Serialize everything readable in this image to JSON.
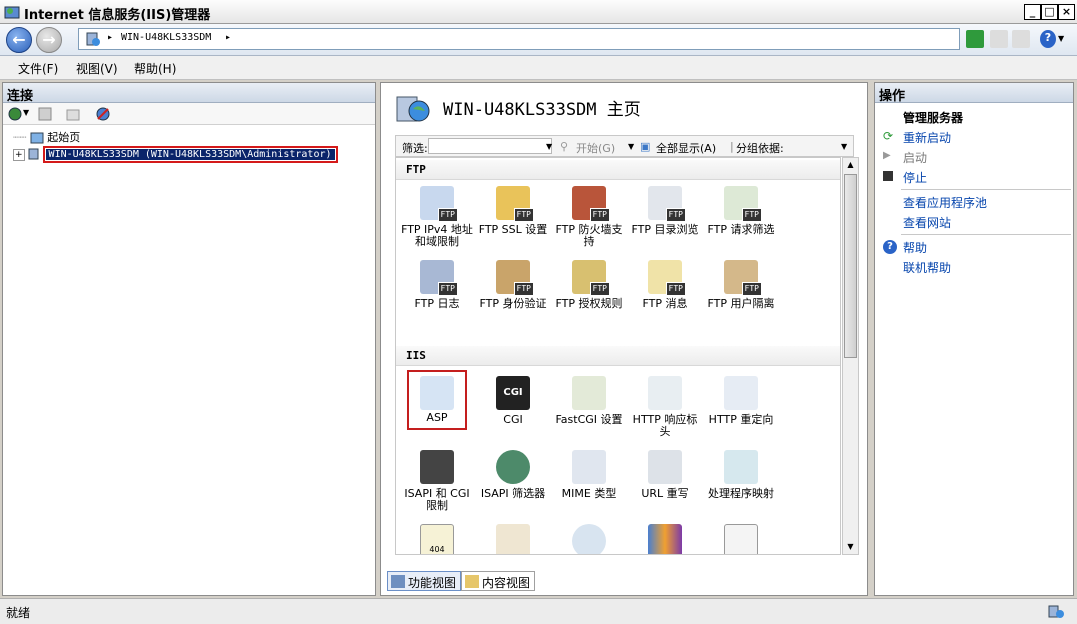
{
  "window": {
    "title": "Internet 信息服务(IIS)管理器"
  },
  "address": {
    "crumbs": [
      "WIN-U48KLS33SDM"
    ]
  },
  "menu": [
    "文件(F)",
    "视图(V)",
    "帮助(H)"
  ],
  "connections": {
    "title": "连接",
    "tree": [
      {
        "label": "起始页"
      },
      {
        "label": "WIN-U48KLS33SDM (WIN-U48KLS33SDM\\Administrator)",
        "selected": true
      }
    ]
  },
  "center": {
    "title": "WIN-U48KLS33SDM 主页",
    "filter": {
      "label": "筛选:",
      "start": "开始(G)",
      "show_all": "全部显示(A)",
      "group_by": "分组依据:"
    },
    "sections": [
      {
        "name": "FTP",
        "items": [
          {
            "label": "FTP IPv4 地址和域限制",
            "icon": "ftp-ip-restrict-icon"
          },
          {
            "label": "FTP SSL 设置",
            "icon": "ftp-ssl-icon"
          },
          {
            "label": "FTP 防火墙支持",
            "icon": "ftp-firewall-icon"
          },
          {
            "label": "FTP 目录浏览",
            "icon": "ftp-directory-icon"
          },
          {
            "label": "FTP 请求筛选",
            "icon": "ftp-request-filter-icon"
          },
          {
            "label": "FTP 日志",
            "icon": "ftp-log-icon"
          },
          {
            "label": "FTP 身份验证",
            "icon": "ftp-auth-icon"
          },
          {
            "label": "FTP 授权规则",
            "icon": "ftp-authz-icon"
          },
          {
            "label": "FTP 消息",
            "icon": "ftp-message-icon"
          },
          {
            "label": "FTP 用户隔离",
            "icon": "ftp-user-isolation-icon"
          }
        ]
      },
      {
        "name": "IIS",
        "items": [
          {
            "label": "ASP",
            "icon": "asp-icon",
            "selected": true
          },
          {
            "label": "CGI",
            "icon": "cgi-icon"
          },
          {
            "label": "FastCGI 设置",
            "icon": "fastcgi-icon"
          },
          {
            "label": "HTTP 响应标头",
            "icon": "http-headers-icon"
          },
          {
            "label": "HTTP 重定向",
            "icon": "http-redirect-icon"
          },
          {
            "label": "ISAPI 和 CGI 限制",
            "icon": "isapi-cgi-icon"
          },
          {
            "label": "ISAPI 筛选器",
            "icon": "isapi-filter-icon"
          },
          {
            "label": "MIME 类型",
            "icon": "mime-icon"
          },
          {
            "label": "URL 重写",
            "icon": "url-rewrite-icon"
          },
          {
            "label": "处理程序映射",
            "icon": "handler-icon"
          },
          {
            "label": "",
            "icon": "error-404-icon"
          },
          {
            "label": "",
            "icon": "certificates-icon"
          },
          {
            "label": "",
            "icon": "compression-icon"
          },
          {
            "label": "",
            "icon": "default-doc-icon"
          },
          {
            "label": "",
            "icon": "document-check-icon"
          }
        ]
      }
    ],
    "tabs": [
      "功能视图",
      "内容视图"
    ]
  },
  "actions": {
    "title": "操作",
    "group": "管理服务器",
    "restart": "重新启动",
    "start": "启动",
    "stop": "停止",
    "view_pools": "查看应用程序池",
    "view_sites": "查看网站",
    "help": "帮助",
    "online_help": "联机帮助"
  },
  "status": {
    "text": "就绪"
  },
  "colors": {
    "selection": "#0a246a",
    "highlight_red": "#c41e1e",
    "link": "#0645ad"
  }
}
